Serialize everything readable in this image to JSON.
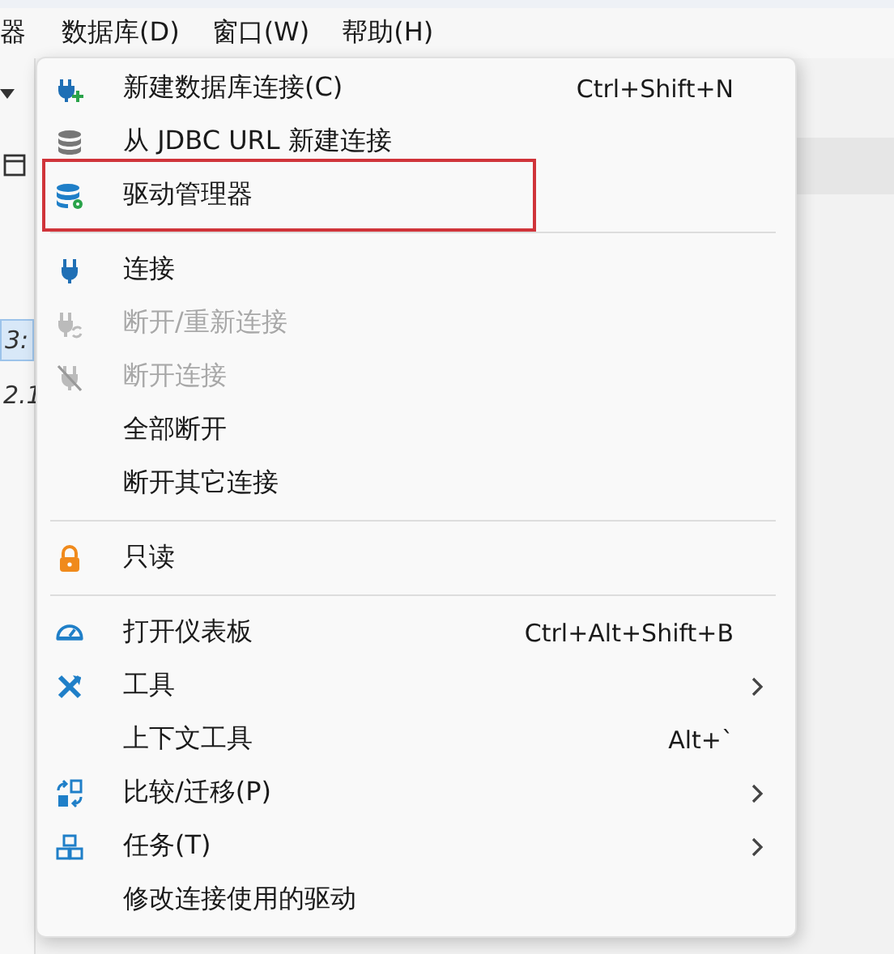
{
  "menubar": {
    "items": [
      {
        "label": "器"
      },
      {
        "label": "数据库(D)"
      },
      {
        "label": "窗口(W)"
      },
      {
        "label": "帮助(H)"
      }
    ]
  },
  "left_strip": {
    "texts": [
      {
        "label": "3:",
        "selected": true
      },
      {
        "label": "2.1",
        "selected": false
      }
    ]
  },
  "menu": {
    "items": [
      {
        "kind": "item",
        "label": "新建数据库连接(C)",
        "shortcut": "Ctrl+Shift+N",
        "disabled": false,
        "submenu": false,
        "annotated": false
      },
      {
        "kind": "item",
        "label": "从 JDBC URL 新建连接",
        "disabled": false,
        "submenu": false,
        "annotated": false
      },
      {
        "kind": "item",
        "label": "驱动管理器",
        "disabled": false,
        "submenu": false,
        "annotated": true
      },
      {
        "kind": "separator"
      },
      {
        "kind": "item",
        "label": "连接",
        "disabled": false,
        "submenu": false,
        "annotated": false
      },
      {
        "kind": "item",
        "label": "断开/重新连接",
        "disabled": true,
        "submenu": false,
        "annotated": false
      },
      {
        "kind": "item",
        "label": "断开连接",
        "disabled": true,
        "submenu": false,
        "annotated": false
      },
      {
        "kind": "item",
        "label": "全部断开",
        "disabled": false,
        "submenu": false,
        "annotated": false
      },
      {
        "kind": "item",
        "label": "断开其它连接",
        "disabled": false,
        "submenu": false,
        "annotated": false
      },
      {
        "kind": "separator"
      },
      {
        "kind": "item",
        "label": "只读",
        "disabled": false,
        "submenu": false,
        "annotated": false
      },
      {
        "kind": "separator"
      },
      {
        "kind": "item",
        "label": "打开仪表板",
        "shortcut": "Ctrl+Alt+Shift+B",
        "disabled": false,
        "submenu": false,
        "annotated": false
      },
      {
        "kind": "item",
        "label": "工具",
        "disabled": false,
        "submenu": true,
        "annotated": false
      },
      {
        "kind": "item",
        "label": "上下文工具",
        "shortcut": "Alt+`",
        "disabled": false,
        "submenu": false,
        "annotated": false
      },
      {
        "kind": "item",
        "label": "比较/迁移(P)",
        "disabled": false,
        "submenu": true,
        "annotated": false
      },
      {
        "kind": "item",
        "label": "任务(T)",
        "disabled": false,
        "submenu": true,
        "annotated": false
      },
      {
        "kind": "item",
        "label": "修改连接使用的驱动",
        "disabled": false,
        "submenu": false,
        "annotated": false
      }
    ]
  }
}
